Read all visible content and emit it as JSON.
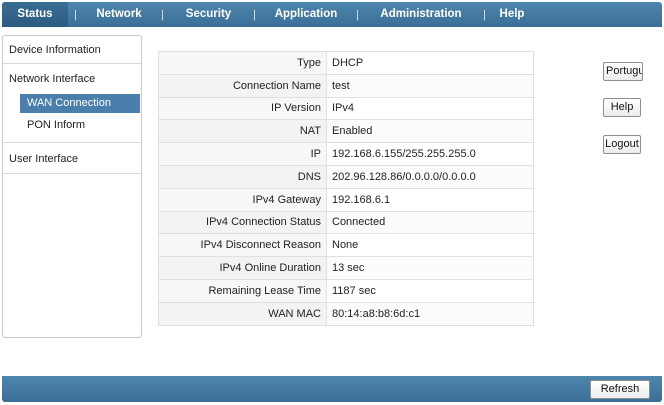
{
  "nav": {
    "tabs": [
      {
        "label": "Status"
      },
      {
        "label": "Network"
      },
      {
        "label": "Security"
      },
      {
        "label": "Application"
      },
      {
        "label": "Administration"
      },
      {
        "label": "Help"
      }
    ],
    "separator": "|"
  },
  "sidebar": {
    "device_information": "Device Information",
    "network_interface": "Network Interface",
    "wan_connection": "WAN Connection",
    "pon_inform": "PON Inform",
    "user_interface": "User Interface"
  },
  "wan": {
    "rows": [
      {
        "key": "Type",
        "value": "DHCP"
      },
      {
        "key": "Connection Name",
        "value": "test"
      },
      {
        "key": "IP Version",
        "value": "IPv4"
      },
      {
        "key": "NAT",
        "value": "Enabled"
      },
      {
        "key": "IP",
        "value": "192.168.6.155/255.255.255.0"
      },
      {
        "key": "DNS",
        "value": "202.96.128.86/0.0.0.0/0.0.0.0"
      },
      {
        "key": "IPv4 Gateway",
        "value": "192.168.6.1"
      },
      {
        "key": "IPv4 Connection Status",
        "value": "Connected"
      },
      {
        "key": "IPv4 Disconnect Reason",
        "value": "None"
      },
      {
        "key": "IPv4 Online Duration",
        "value": "13 sec"
      },
      {
        "key": "Remaining Lease Time",
        "value": "1187 sec"
      },
      {
        "key": "WAN MAC",
        "value": "80:14:a8:b8:6d:c1"
      }
    ]
  },
  "buttons": {
    "language": "Portugu",
    "help": "Help",
    "logout": "Logout",
    "refresh": "Refresh"
  },
  "colors": {
    "nav_bar": "#4a7fa8",
    "active_tab": "#2f5f86",
    "sidebar_active": "#4a7fab"
  }
}
